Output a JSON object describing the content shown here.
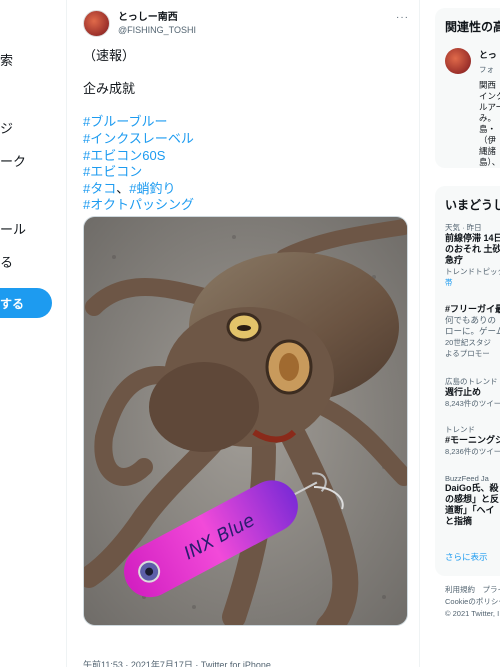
{
  "left_nav": {
    "items": [
      "索",
      "ジ",
      "ーク",
      "ール",
      "る"
    ],
    "tweet_button": "する"
  },
  "tweet": {
    "display_name": "とっしー南西",
    "handle": "@FISHING_TOSHI",
    "lines": [
      "（速報）",
      "",
      "企み成就",
      ""
    ],
    "hashtags": [
      "#ブルーブルー",
      "#インクスレーベル",
      "#エビコン60S",
      "#エビコン"
    ],
    "hashtag_mixed": {
      "tag1": "#タコ",
      "sep": "、",
      "tag2": "#蛸釣り"
    },
    "hashtag_last": "#オクトパッシング",
    "media_alt": "",
    "lure_text": "INX Blue",
    "timestamp": "午前11:53 · 2021年7月17日 · Twitter for iPhone"
  },
  "sidebar": {
    "related": {
      "title": "関連性の高",
      "name": "とっ",
      "follow": "フォ",
      "bio_lines": [
        "関西",
        "インク",
        "ルアー",
        "み。",
        "島・",
        "（伊",
        "縄諸",
        "島）、"
      ]
    },
    "trends": {
      "title": "いまどうし",
      "items": [
        {
          "meta": "天気 · 昨日",
          "lines": [
            "前線停滞 14日",
            "のおそれ 土砂",
            "急疗"
          ],
          "sub": "トレンドトピック",
          "sub2": "帯"
        },
        {
          "meta": "",
          "lines": [
            "#フリーガイ最"
          ],
          "desc": [
            "何でもありの",
            "ローに。ゲーム"
          ],
          "promo": [
            "20世紀スタジ",
            "よるプロモー"
          ]
        },
        {
          "meta": "広島のトレンド",
          "lines": [
            "週行止め"
          ],
          "count": "8,243件のツイー"
        },
        {
          "meta": "トレンド",
          "lines": [
            "#モーニングシ"
          ],
          "count": "8,236件のツイー"
        },
        {
          "meta": "BuzzFeed Ja",
          "lines": [
            "DaiGo氏、殺",
            "の感想」と反",
            "道断」「ヘイ",
            "と指摘"
          ]
        }
      ],
      "show_more": "さらに表示"
    },
    "footer": [
      "利用規約　プライ",
      "Cookieのポリシー",
      "© 2021 Twitter, I"
    ]
  },
  "colors": {
    "accent": "#1d9bf0",
    "secondary_text": "#536471",
    "lure_pink": "#e63ad1"
  }
}
